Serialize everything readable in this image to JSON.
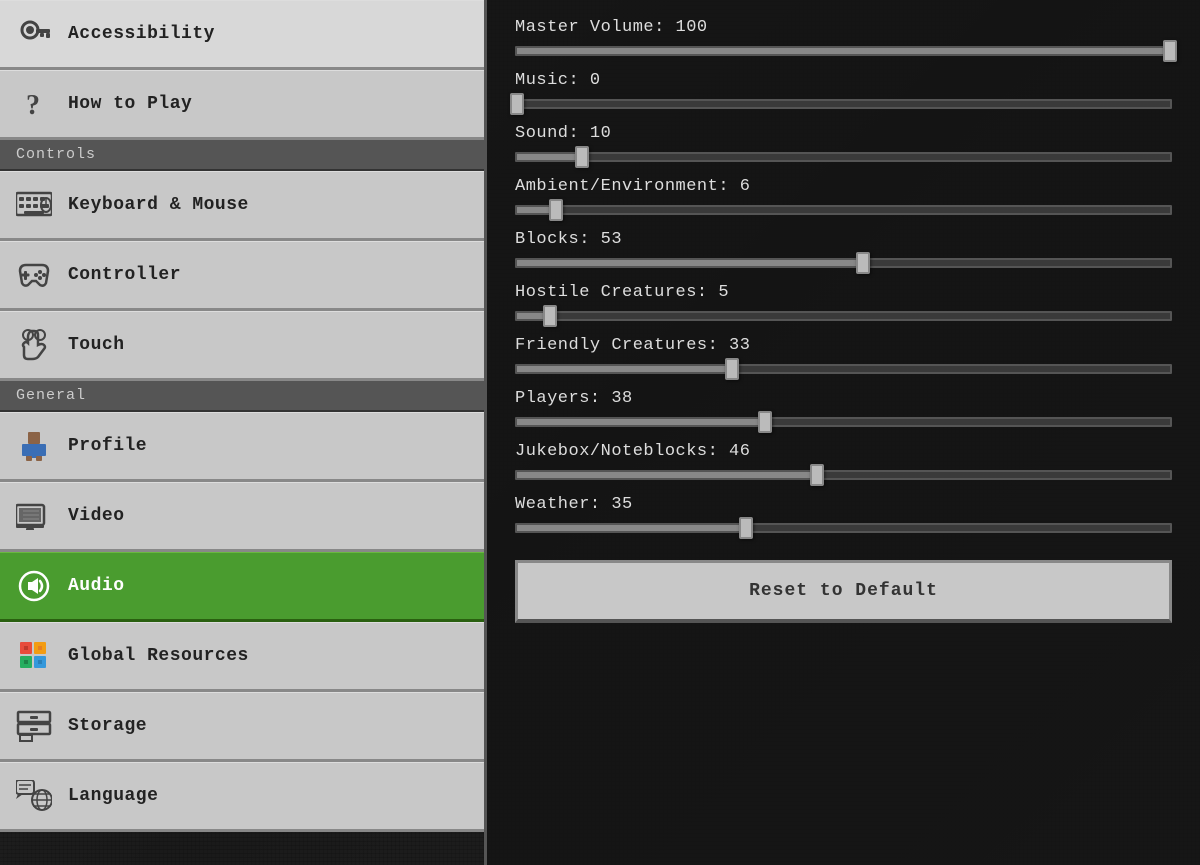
{
  "sidebar": {
    "items_top": [
      {
        "id": "accessibility",
        "label": "Accessibility",
        "icon": "key"
      },
      {
        "id": "how-to-play",
        "label": "How to Play",
        "icon": "question"
      }
    ],
    "controls_header": "Controls",
    "controls_items": [
      {
        "id": "keyboard-mouse",
        "label": "Keyboard & Mouse",
        "icon": "keyboard"
      },
      {
        "id": "controller",
        "label": "Controller",
        "icon": "controller"
      },
      {
        "id": "touch",
        "label": "Touch",
        "icon": "touch"
      }
    ],
    "general_header": "General",
    "general_items": [
      {
        "id": "profile",
        "label": "Profile",
        "icon": "profile"
      },
      {
        "id": "video",
        "label": "Video",
        "icon": "video"
      },
      {
        "id": "audio",
        "label": "Audio",
        "icon": "audio",
        "active": true
      },
      {
        "id": "global-resources",
        "label": "Global Resources",
        "icon": "resources"
      },
      {
        "id": "storage",
        "label": "Storage",
        "icon": "storage"
      },
      {
        "id": "language",
        "label": "Language",
        "icon": "language"
      }
    ]
  },
  "main": {
    "sliders": [
      {
        "id": "master-volume",
        "label": "Master Volume: 100",
        "value": 100
      },
      {
        "id": "music",
        "label": "Music: 0",
        "value": 0
      },
      {
        "id": "sound",
        "label": "Sound: 10",
        "value": 10
      },
      {
        "id": "ambient",
        "label": "Ambient/Environment: 6",
        "value": 6
      },
      {
        "id": "blocks",
        "label": "Blocks: 53",
        "value": 53
      },
      {
        "id": "hostile-creatures",
        "label": "Hostile Creatures: 5",
        "value": 5
      },
      {
        "id": "friendly-creatures",
        "label": "Friendly Creatures: 33",
        "value": 33
      },
      {
        "id": "players",
        "label": "Players: 38",
        "value": 38
      },
      {
        "id": "jukebox",
        "label": "Jukebox/Noteblocks: 46",
        "value": 46
      },
      {
        "id": "weather",
        "label": "Weather: 35",
        "value": 35
      }
    ],
    "reset_button": "Reset to Default"
  },
  "colors": {
    "active_bg": "#4a9c2f",
    "slider_fill": "#888888",
    "thumb_color": "#bbbbbb"
  }
}
